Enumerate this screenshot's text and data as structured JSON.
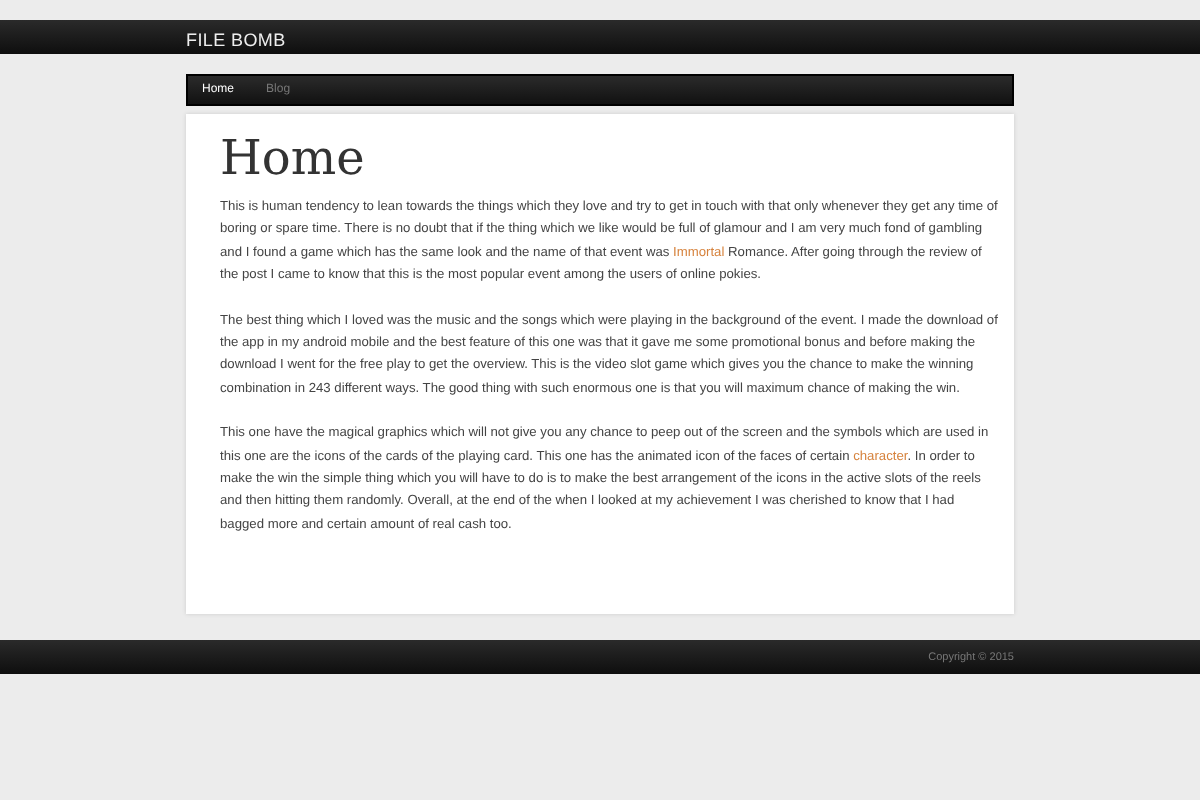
{
  "site_title": "FILE BOMB",
  "nav": [
    {
      "label": "Home",
      "selected": true
    },
    {
      "label": "Blog",
      "selected": false
    }
  ],
  "page_title": "Home",
  "paragraphs": [
    [
      {
        "kind": "text",
        "text": "This is human tendency to lean towards the things which they love and try to get in touch with that only whenever they get any time of boring or spare time. There is no doubt that if the thing which we like would be full of glamour and I am very much fond of gambling and I found a game which has the same look and the name of that event was "
      },
      {
        "kind": "link",
        "text": "Immortal"
      },
      {
        "kind": "text",
        "text": " Romance. After going through the review of the post I came to know that this is the most popular event among the users of online pokies."
      }
    ],
    [
      {
        "kind": "text",
        "text": "The best thing which I loved was the music and the songs which were playing in the background of the event. I made the download of the app in my android mobile and the best feature of this one was that it gave me some promotional bonus and before making the download I went for the free play to get the overview. This is the video slot game which gives you the chance to make the winning combination in 243 different ways. The good thing with such enormous one is that you will maximum chance of making the win."
      }
    ],
    [
      {
        "kind": "text",
        "text": "This one have the magical graphics which will not give you any chance to peep out of the screen and the symbols which are used in this one are the icons of the cards of the playing card. This one has the animated icon of the faces of certain "
      },
      {
        "kind": "link",
        "text": "character"
      },
      {
        "kind": "text",
        "text": ". In order to make the win the simple thing which you will have to do is to make the best arrangement of the icons in the active slots of the reels and then hitting them randomly. Overall, at the end of the when I looked at my achievement I was cherished to know that I had bagged more and certain amount of real cash too."
      }
    ]
  ],
  "footer": "Copyright © 2015"
}
